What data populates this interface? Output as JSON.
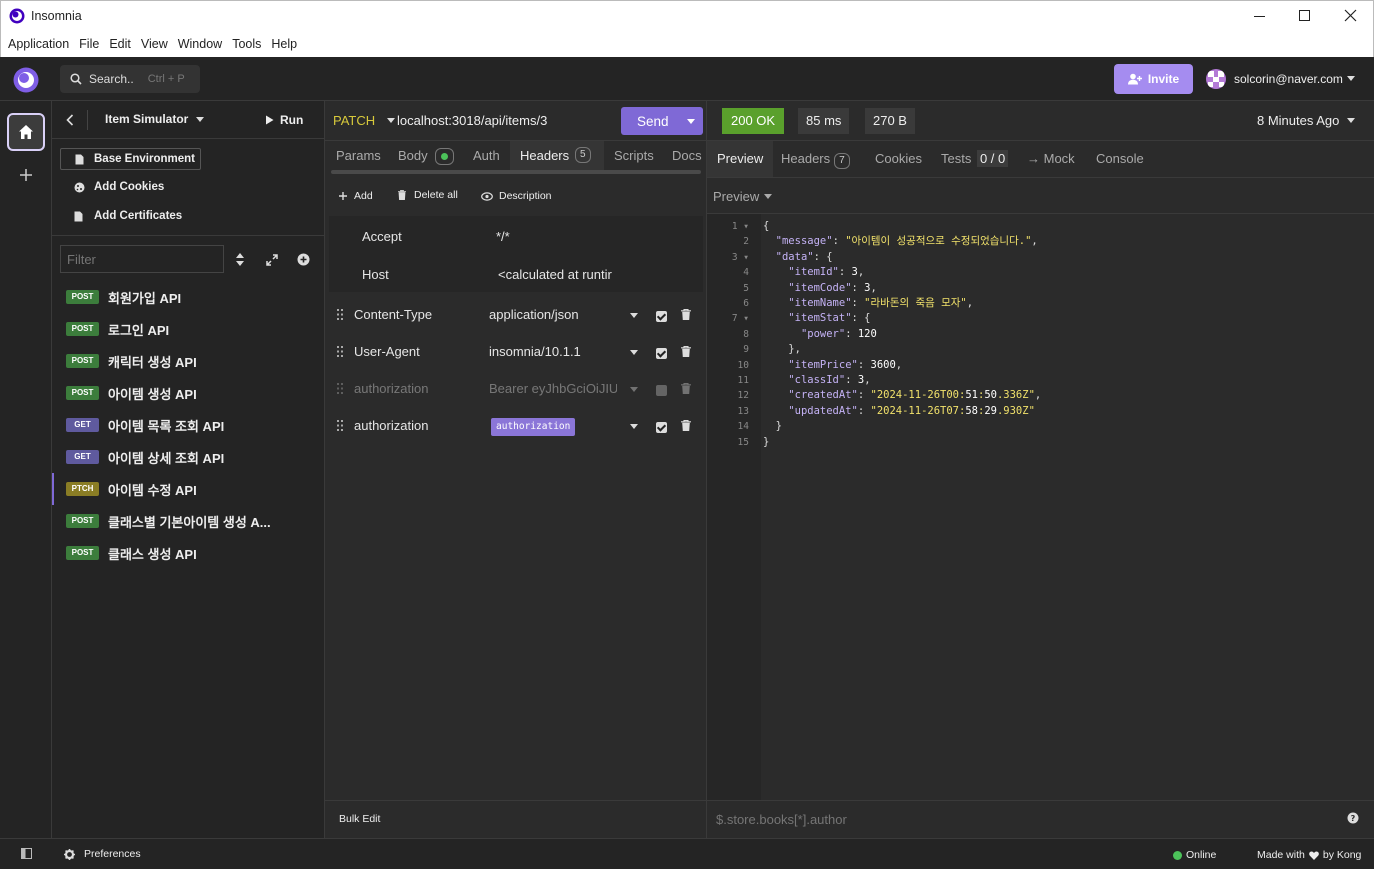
{
  "window": {
    "title": "Insomnia",
    "controls": [
      "minimize-icon",
      "maximize-icon",
      "close-icon"
    ]
  },
  "menu": [
    "Application",
    "File",
    "Edit",
    "View",
    "Window",
    "Tools",
    "Help"
  ],
  "topbar": {
    "search_label": "Search..",
    "search_shortcut": "Ctrl + P",
    "invite_label": "Invite",
    "user_email": "solcorin@naver.com"
  },
  "sidebar": {
    "collection_name": "Item Simulator",
    "run_label": "Run",
    "base_environment": "Base Environment",
    "add_cookies": "Add Cookies",
    "add_certificates": "Add Certificates",
    "filter_placeholder": "Filter",
    "requests": [
      {
        "method": "POST",
        "name": "회원가입 API"
      },
      {
        "method": "POST",
        "name": "로그인 API"
      },
      {
        "method": "POST",
        "name": "캐릭터 생성 API"
      },
      {
        "method": "POST",
        "name": "아이템 생성 API"
      },
      {
        "method": "GET",
        "name": "아이템 목록 조회 API"
      },
      {
        "method": "GET",
        "name": "아이템 상세 조회 API"
      },
      {
        "method": "PTCH",
        "name": "아이템 수정 API"
      },
      {
        "method": "POST",
        "name": "클래스별 기본아이템 생성 A..."
      },
      {
        "method": "POST",
        "name": "클래스 생성 API"
      }
    ],
    "active_index": 6
  },
  "request": {
    "method": "PATCH",
    "url": "localhost:3018/api/items/3",
    "send_label": "Send",
    "tabs": [
      "Params",
      "Body",
      "Auth",
      "Headers",
      "Scripts",
      "Docs"
    ],
    "headers_count": "5",
    "active_tab": "Headers",
    "toolbar": {
      "add": "Add",
      "delete_all": "Delete all",
      "description": "Description"
    },
    "auto_headers": [
      {
        "key": "Accept",
        "value": "*/*"
      },
      {
        "key": "Host",
        "value": "<calculated at runtir"
      }
    ],
    "headers": [
      {
        "key": "Content-Type",
        "value": "application/json",
        "enabled": true
      },
      {
        "key": "User-Agent",
        "value": "insomnia/10.1.1",
        "enabled": true
      },
      {
        "key": "authorization",
        "value": "Bearer eyJhbGciOiJIUz",
        "enabled": false
      },
      {
        "key": "authorization",
        "value": "authorization",
        "enabled": true,
        "is_tag": true
      }
    ],
    "bulk_edit": "Bulk Edit"
  },
  "response": {
    "status": "200 OK",
    "time": "85 ms",
    "size": "270 B",
    "age": "8 Minutes Ago",
    "tabs": [
      "Preview",
      "Headers",
      "Cookies",
      "Tests",
      "→ Mock",
      "Console"
    ],
    "headers_count": "7",
    "tests_count": "0 / 0",
    "active_tab": "Preview",
    "preview_mode": "Preview",
    "filter_placeholder": "$.store.books[*].author",
    "lines": [
      "{",
      "  \"message\": \"아이템이 성공적으로 수정되었습니다.\",",
      "  \"data\": {",
      "    \"itemId\": 3,",
      "    \"itemCode\": 3,",
      "    \"itemName\": \"라바돈의 죽음 모자\",",
      "    \"itemStat\": {",
      "      \"power\": 120",
      "    },",
      "    \"itemPrice\": 3600,",
      "    \"classId\": 3,",
      "    \"createdAt\": \"2024-11-26T00:51:50.336Z\",",
      "    \"updatedAt\": \"2024-11-26T07:58:29.930Z\"",
      "  }",
      "}"
    ]
  },
  "statusbar": {
    "preferences": "Preferences",
    "online": "Online",
    "made_with": "Made with",
    "by": "by Kong"
  },
  "colors": {
    "accent": "#7f69d6",
    "status_ok": "#5aa02c",
    "online": "#4cc25a"
  }
}
